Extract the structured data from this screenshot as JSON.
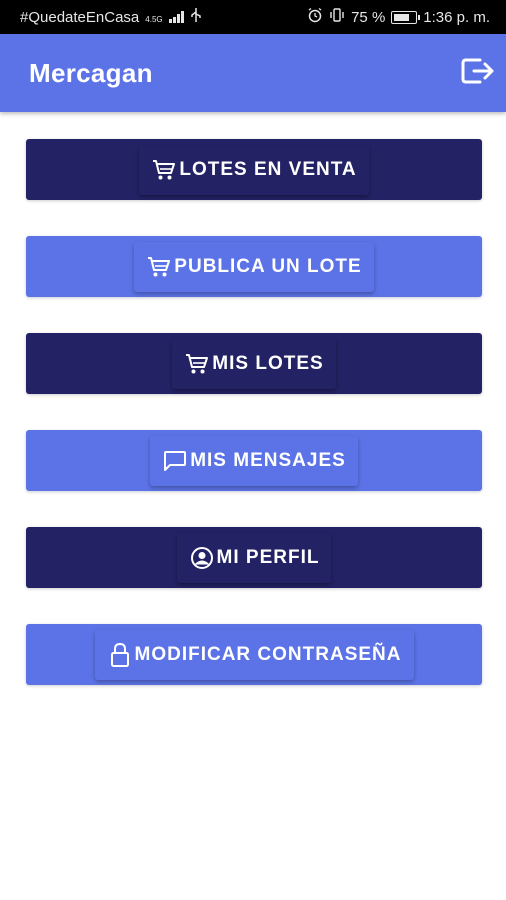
{
  "status_bar": {
    "carrier_text": "#QuedateEnCasa",
    "network": "4.5G",
    "battery": "75 %",
    "battery_level": 0.75,
    "time": "1:36 p. m."
  },
  "app_bar": {
    "title": "Mercagan",
    "logout_icon": "logout-icon"
  },
  "menu": [
    {
      "label": "LOTES EN VENTA",
      "icon": "cart-icon",
      "style": "dark"
    },
    {
      "label": "PUBLICA UN LOTE",
      "icon": "cart-icon",
      "style": "light"
    },
    {
      "label": "MIS LOTES",
      "icon": "cart-icon",
      "style": "dark"
    },
    {
      "label": "MIS MENSAJES",
      "icon": "chat-icon",
      "style": "light"
    },
    {
      "label": "MI PERFIL",
      "icon": "account-circle-icon",
      "style": "dark"
    },
    {
      "label": "MODIFICAR CONTRASEÑA",
      "icon": "lock-icon",
      "style": "light"
    }
  ],
  "colors": {
    "primary": "#5b73e6",
    "dark_button": "#232265"
  }
}
